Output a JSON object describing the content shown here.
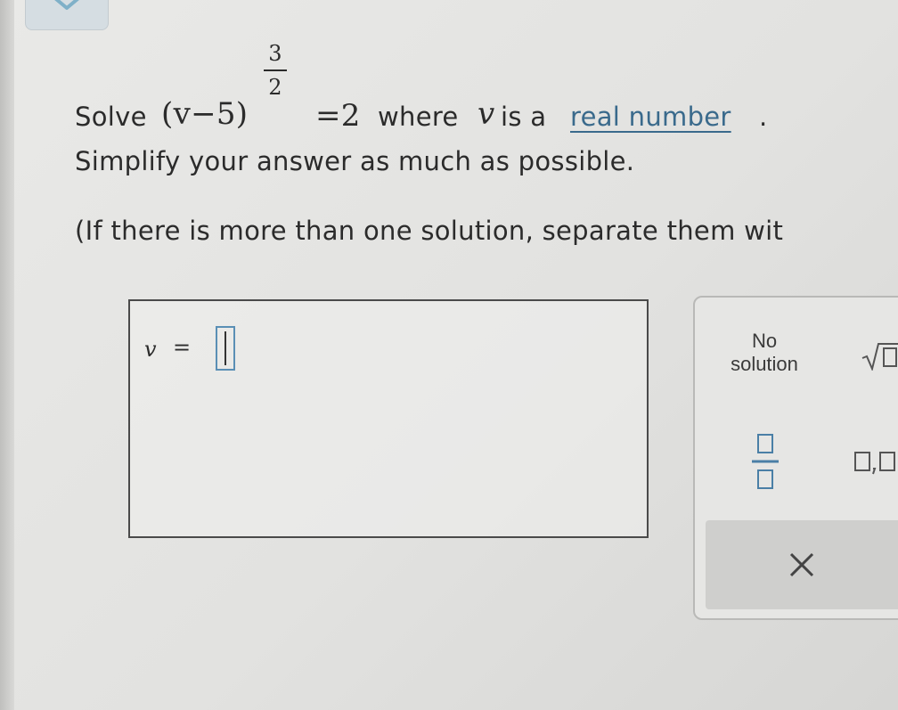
{
  "question": {
    "solve_label": "Solve",
    "expression_base": "(v−5)",
    "exponent_numerator": "3",
    "exponent_denominator": "2",
    "rhs": "=2",
    "where_label": "where",
    "variable": "v",
    "is_a_label": "is a",
    "link_text": "real number",
    "period": ".",
    "line2": "Simplify your answer as much as possible.",
    "line3": "(If there is more than one solution, separate them wit"
  },
  "answer": {
    "variable_label": "v",
    "equals": "=",
    "input_value": ""
  },
  "toolbox": {
    "no_solution_line1": "No",
    "no_solution_line2": "solution",
    "sqrt_icon": "square-root-icon",
    "fraction_icon": "fraction-icon",
    "comma_list_icon": "comma-list-icon",
    "clear_icon": "close-icon"
  },
  "colors": {
    "link": "#3a6a8c",
    "input_border": "#5a8fb5",
    "collapse_tab": "#d5dde2",
    "chevron": "#7fb0c8"
  }
}
